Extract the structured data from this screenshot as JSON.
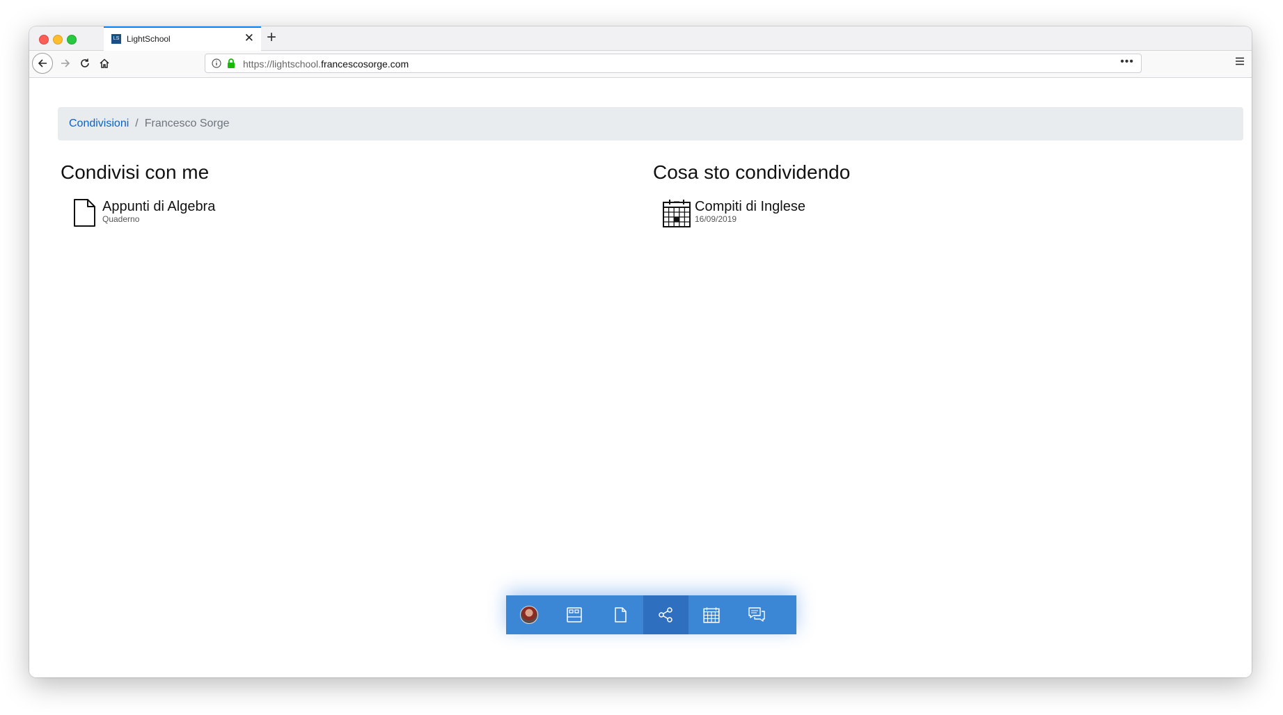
{
  "browser": {
    "tab": {
      "title": "LightSchool",
      "favicon_text": "LS"
    },
    "url": {
      "prefix": "https://lightschool.",
      "domain": "francescosorge.com"
    }
  },
  "breadcrumb": {
    "parent": "Condivisioni",
    "separator": "/",
    "current": "Francesco Sorge"
  },
  "shared_with_me": {
    "title": "Condivisi con me",
    "items": [
      {
        "title": "Appunti di Algebra",
        "subtitle": "Quaderno",
        "icon": "document-icon"
      }
    ]
  },
  "sharing": {
    "title": "Cosa sto condividendo",
    "items": [
      {
        "title": "Compiti di Inglese",
        "subtitle": "16/09/2019",
        "icon": "calendar-icon"
      }
    ]
  },
  "dock": {
    "items": [
      {
        "icon": "user-avatar"
      },
      {
        "icon": "desktop-icon"
      },
      {
        "icon": "file-icon"
      },
      {
        "icon": "share-icon",
        "active": true
      },
      {
        "icon": "calendar-icon"
      },
      {
        "icon": "messages-icon"
      }
    ]
  },
  "colors": {
    "accent": "#0a62c9",
    "dock": "#3c86d6",
    "dock_active": "#2f6fbf",
    "breadcrumb_bg": "#e9ecef"
  }
}
